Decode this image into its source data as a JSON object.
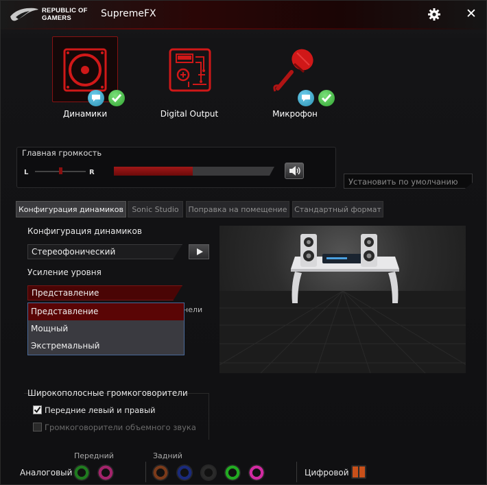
{
  "titlebar": {
    "brand_line1": "REPUBLIC OF",
    "brand_line2": "GAMERS",
    "title": "SupremeFX",
    "close_glyph": "✕"
  },
  "devices": [
    {
      "label": "Динамики",
      "icon": "speaker-icon",
      "active": true
    },
    {
      "label": "Digital Output",
      "icon": "circuit-icon",
      "active": false
    },
    {
      "label": "Микрофон",
      "icon": "microphone-icon",
      "active": false
    }
  ],
  "volume": {
    "title": "Главная громкость",
    "left_label": "L",
    "right_label": "R",
    "balance": 0.5,
    "level": 0.49
  },
  "default_button": "Установить по умолчанию",
  "tabs": [
    "Конфигурация динамиков",
    "Sonic Studio",
    "Поправка на помещение",
    "Стандартный формат"
  ],
  "config": {
    "speaker_config_label": "Конфигурация динамиков",
    "speaker_config_value": "Стереофонический",
    "level_boost_label": "Усиление уровня",
    "level_boost_value": "Представление",
    "hidden_text_fragment": "нели",
    "dropdown_options": [
      "Представление",
      "Мощный",
      "Экстремальный"
    ],
    "wideband_label": "Широкополосные громкоговорители",
    "front_lr_label": "Передние левый и правый",
    "surround_label": "Громкоговорители объемного звука"
  },
  "jacks": {
    "analog_label": "Аналоговый",
    "front_label": "Передний",
    "rear_label": "Задний",
    "digital_label": "Цифровой",
    "front": [
      "#1f7a1f",
      "#a3246b"
    ],
    "rear": [
      "#7a3a1a",
      "#1a2a7a",
      "#2a2a2a",
      "#22aa22",
      "#d02aa0"
    ]
  },
  "colors": {
    "accent": "#c0141a",
    "badge_blue": "#2a8fb0",
    "badge_green": "#2fa32f"
  }
}
